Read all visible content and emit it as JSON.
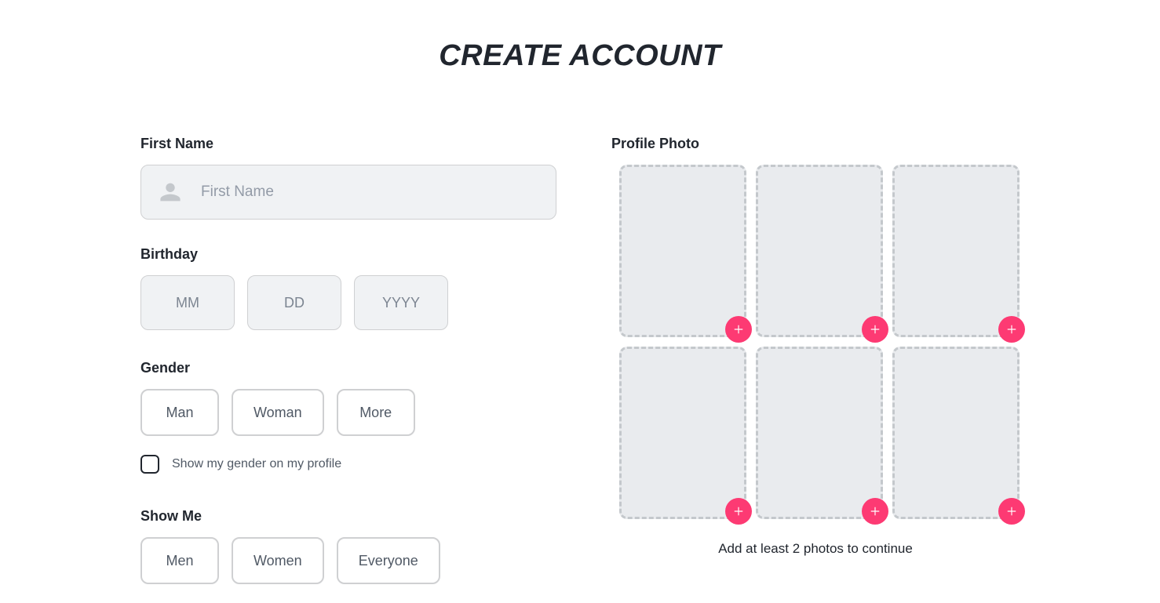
{
  "title": "CREATE ACCOUNT",
  "firstName": {
    "label": "First Name",
    "placeholder": "First Name",
    "value": ""
  },
  "birthday": {
    "label": "Birthday",
    "month_ph": "MM",
    "day_ph": "DD",
    "year_ph": "YYYY"
  },
  "gender": {
    "label": "Gender",
    "options": [
      "Man",
      "Woman",
      "More"
    ],
    "showOnProfileLabel": "Show my gender on my profile"
  },
  "showMe": {
    "label": "Show Me",
    "options": [
      "Men",
      "Women",
      "Everyone"
    ]
  },
  "profilePhoto": {
    "label": "Profile Photo",
    "hint": "Add at least 2 photos to continue",
    "slotCount": 6
  },
  "colors": {
    "accent": "#fd3a73"
  }
}
